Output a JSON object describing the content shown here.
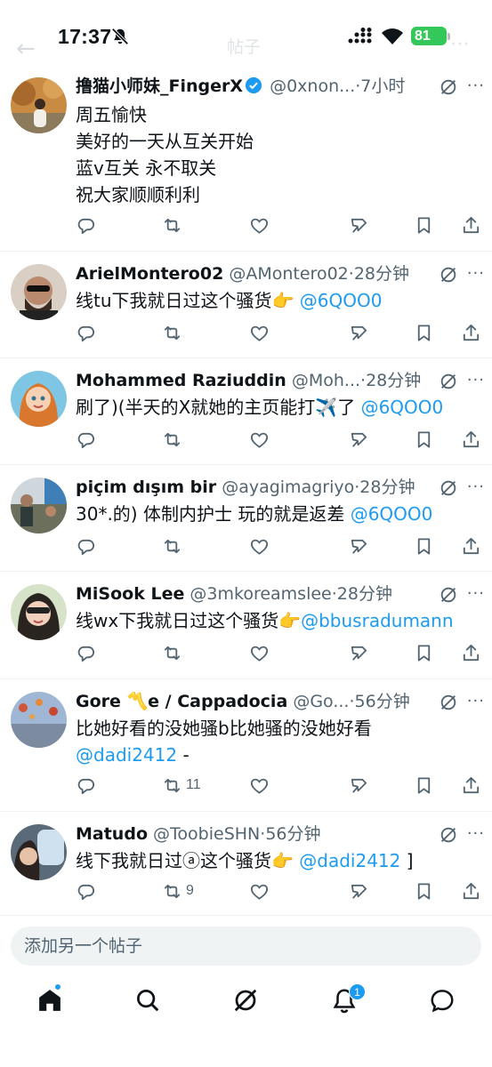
{
  "status_bar": {
    "time": "17:37",
    "battery": "81"
  },
  "header": {
    "title": "帖子"
  },
  "posts": [
    {
      "name": "撸猫小师妹_FingerX",
      "handle": "@0xnon...",
      "time": "7小时",
      "verified": true,
      "lines": [
        "周五愉快",
        "美好的一天从互关开始",
        "蓝v互关  永不取关",
        "祝大家顺顺利利"
      ],
      "retweets": ""
    },
    {
      "name": "ArielMontero02",
      "handle": "@AMontero02",
      "time": "28分钟",
      "text": "线tu下我就日过这个骚货👉",
      "mention": "@6QOO0",
      "retweets": ""
    },
    {
      "name": "Mohammed Raziuddin",
      "handle": "@Moh...",
      "time": "28分钟",
      "text": "刷了)(半天的X就她的主页能打✈️了",
      "mention": "@6QOO0",
      "retweets": ""
    },
    {
      "name": "piçim dışım bir",
      "handle": "@ayagimagriyo",
      "time": "28分钟",
      "text": "30*.的) 体制内护士 玩的就是返差",
      "mention": "@6QOO0",
      "retweets": ""
    },
    {
      "name": "MiSook Lee",
      "handle": "@3mkoreamslee",
      "time": "28分钟",
      "text": "线wx下我就日过这个骚货👉",
      "mention": "@bbusradumann",
      "retweets": ""
    },
    {
      "name": "Gore 〽️e / Cappadocia",
      "handle": "@Go...",
      "time": "56分钟",
      "text": "比她好看的没她骚b比她骚的没她好看",
      "mention": "@dadi2412",
      "after_mention": " -",
      "mention_newline": true,
      "retweets": "11"
    },
    {
      "name": "Matudo",
      "handle": "@ToobieSHN",
      "time": "56分钟",
      "text": "线下我就日过ⓐ这个骚货👉",
      "mention": "@dadi2412",
      "after_mention": " ]",
      "retweets": "9"
    }
  ],
  "reply": {
    "placeholder": "添加另一个帖子"
  },
  "nav": {
    "notifications_badge": "1"
  },
  "colors": {
    "accent": "#1d9bf0",
    "text": "#0f1419",
    "muted": "#536471"
  },
  "icons": [
    "reply-icon",
    "repost-icon",
    "like-icon",
    "views-icon",
    "bookmark-icon",
    "share-icon",
    "grok-icon",
    "more-icon",
    "home-icon",
    "search-icon",
    "notifications-icon",
    "messages-icon"
  ]
}
